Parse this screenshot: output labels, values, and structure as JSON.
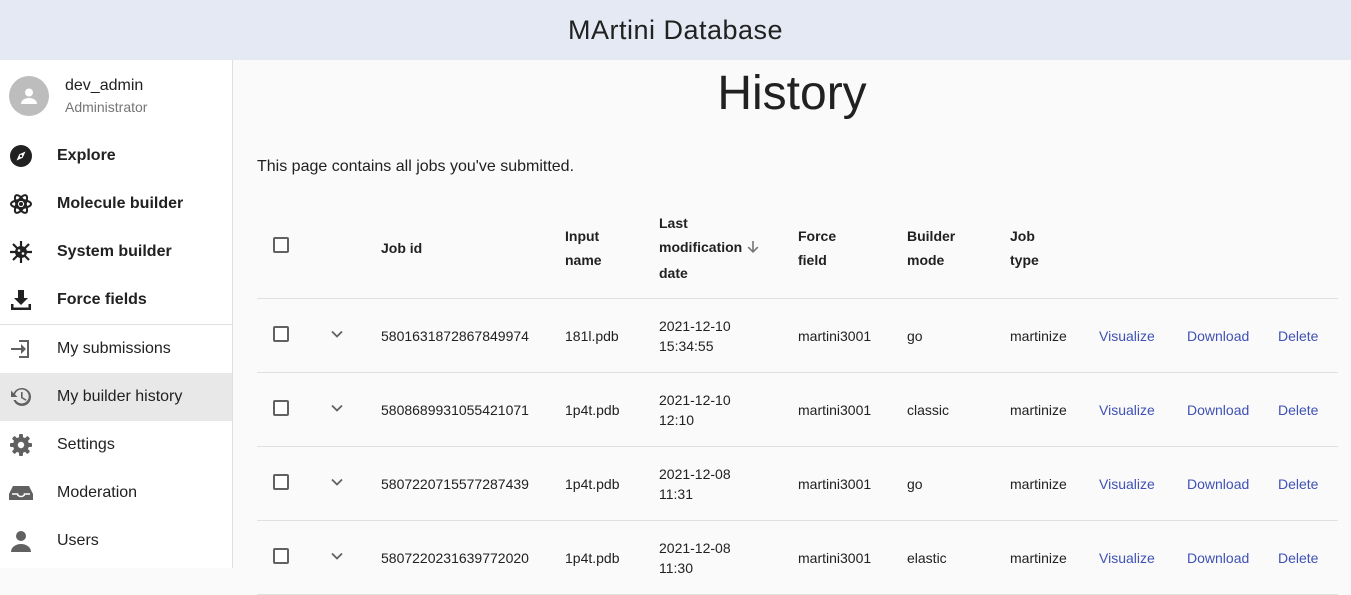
{
  "app": {
    "title": "MArtini Database"
  },
  "user": {
    "name": "dev_admin",
    "role": "Administrator"
  },
  "nav": [
    {
      "label": "Explore",
      "icon": "compass-icon"
    },
    {
      "label": "Molecule builder",
      "icon": "atom-icon"
    },
    {
      "label": "System builder",
      "icon": "virus-icon"
    },
    {
      "label": "Force fields",
      "icon": "download-tray-icon"
    },
    {
      "label": "My submissions",
      "icon": "login-arrow-icon"
    },
    {
      "label": "My builder history",
      "icon": "history-icon"
    },
    {
      "label": "Settings",
      "icon": "gear-icon"
    },
    {
      "label": "Moderation",
      "icon": "inbox-icon"
    },
    {
      "label": "Users",
      "icon": "person-icon"
    }
  ],
  "page": {
    "title": "History",
    "description": "This page contains all jobs you've submitted."
  },
  "table": {
    "headers": {
      "job_id": "Job id",
      "input_name_1": "Input",
      "input_name_2": "name",
      "date_1": "Last",
      "date_2": "modification",
      "date_3": "date",
      "force_field_1": "Force",
      "force_field_2": "field",
      "builder_mode_1": "Builder",
      "builder_mode_2": "mode",
      "job_type_1": "Job",
      "job_type_2": "type"
    },
    "actions": {
      "visualize": "Visualize",
      "download": "Download",
      "delete": "Delete"
    },
    "rows": [
      {
        "job_id": "5801631872867849974",
        "input_name": "181l.pdb",
        "date": "2021-12-10",
        "time": "15:34:55",
        "force_field": "martini3001",
        "builder_mode": "go",
        "job_type": "martinize"
      },
      {
        "job_id": "5808689931055421071",
        "input_name": "1p4t.pdb",
        "date": "2021-12-10",
        "time": "12:10",
        "force_field": "martini3001",
        "builder_mode": "classic",
        "job_type": "martinize"
      },
      {
        "job_id": "5807220715577287439",
        "input_name": "1p4t.pdb",
        "date": "2021-12-08",
        "time": "11:31",
        "force_field": "martini3001",
        "builder_mode": "go",
        "job_type": "martinize"
      },
      {
        "job_id": "5807220231639772020",
        "input_name": "1p4t.pdb",
        "date": "2021-12-08",
        "time": "11:30",
        "force_field": "martini3001",
        "builder_mode": "elastic",
        "job_type": "martinize"
      }
    ]
  }
}
